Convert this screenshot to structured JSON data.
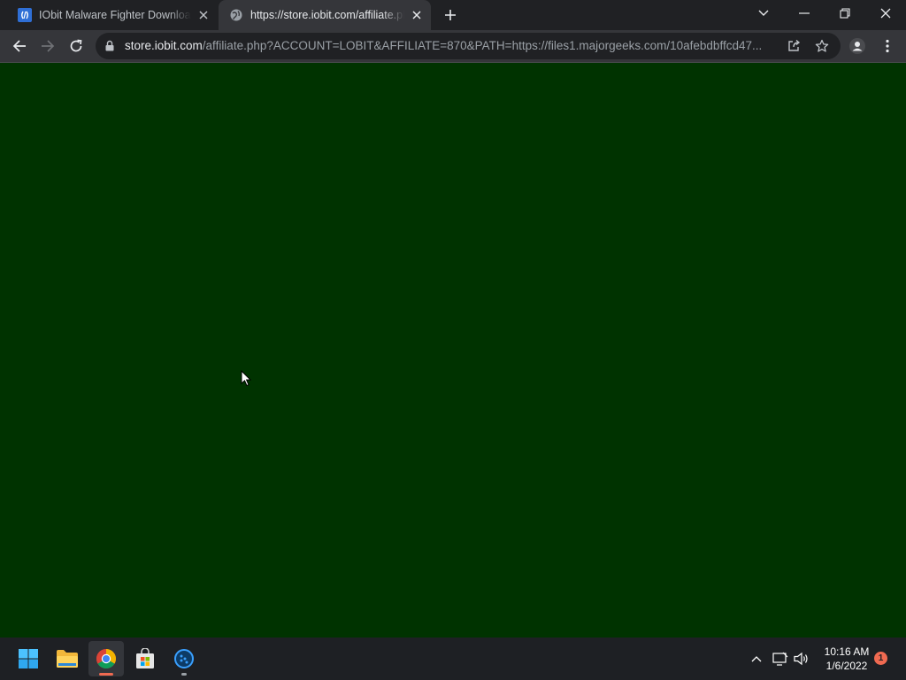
{
  "browser": {
    "tabs": [
      {
        "title": "IObit Malware Fighter Download",
        "favicon": "iobit-icon",
        "active": false
      },
      {
        "title": "https://store.iobit.com/affiliate.php",
        "favicon": "globe-icon",
        "active": true
      }
    ],
    "address": {
      "host": "store.iobit.com",
      "path": "/affiliate.php?ACCOUNT=LOBIT&AFFILIATE=870&PATH=https://files1.majorgeeks.com/10afebdbffcd47..."
    }
  },
  "page": {
    "background_color": "#003300"
  },
  "taskbar": {
    "apps": [
      "start-button",
      "file-explorer",
      "chrome",
      "microsoft-store",
      "iobit-malware-fighter"
    ],
    "clock": {
      "time": "10:16 AM",
      "date": "1/6/2022"
    },
    "notification_count": "1"
  },
  "colors": {
    "tabstrip": "#202124",
    "toolbar": "#35363a",
    "taskbar": "#1e2024",
    "accent": "#8ab4f8"
  }
}
